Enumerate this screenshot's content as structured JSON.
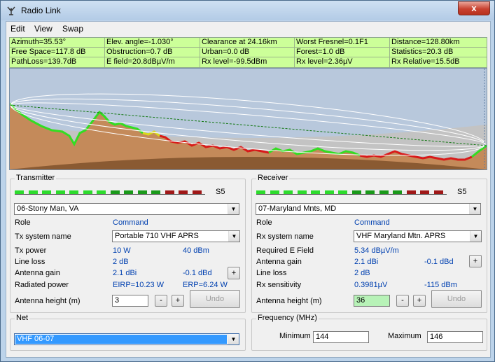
{
  "window": {
    "title": "Radio Link",
    "close_label": "x"
  },
  "menu": {
    "edit": "Edit",
    "view": "View",
    "swap": "Swap"
  },
  "info": {
    "rows": [
      [
        "Azimuth=35.53°",
        "Elev. angle=-1.030°",
        "Clearance at 24.16km",
        "Worst Fresnel=0.1F1",
        "Distance=128.80km"
      ],
      [
        "Free Space=117.8 dB",
        "Obstruction=0.7 dB",
        "Urban=0.0 dB",
        "Forest=1.0 dB",
        "Statistics=20.3 dB"
      ],
      [
        "PathLoss=139.7dB",
        "E field=20.8dBµV/m",
        "Rx level=-99.5dBm",
        "Rx level=2.36µV",
        "Rx Relative=15.5dB"
      ]
    ]
  },
  "colors": {
    "info_bg": "#ccff99",
    "value_blue": "#0040b0",
    "selected_net": "#3399ff",
    "rx_height_bg": "#b7f2b7"
  },
  "meter_colors": [
    "#2ddc2d",
    "#2ddc2d",
    "#2ddc2d",
    "#2ddc2d",
    "#2ddc2d",
    "#2ddc2d",
    "#2ddc2d",
    "#1a9a1a",
    "#1a9a1a",
    "#1a9a1a",
    "#1a9a1a",
    "#a01818",
    "#a01818",
    "#a01818"
  ],
  "transmitter": {
    "legend": "Transmitter",
    "signal": "S5",
    "site": "06-Stony Man, VA",
    "role_label": "Role",
    "role_value": "Command",
    "system_label": "Tx system name",
    "system_value": "Portable 710 VHF APRS",
    "power_label": "Tx power",
    "power_w": "10 W",
    "power_dbm": "40 dBm",
    "loss_label": "Line loss",
    "loss_value": "2 dB",
    "gain_label": "Antenna gain",
    "gain_dbi": "2.1 dBi",
    "gain_dbd": "-0.1 dBd",
    "plus": "+",
    "radiated_label": "Radiated power",
    "eirp": "EIRP=10.23 W",
    "erp": "ERP=6.24 W",
    "height_label": "Antenna height (m)",
    "height_value": "3",
    "minus": "-",
    "undo": "Undo"
  },
  "receiver": {
    "legend": "Receiver",
    "signal": "S5",
    "site": "07-Maryland Mnts, MD",
    "role_label": "Role",
    "role_value": "Command",
    "system_label": "Rx system name",
    "system_value": "VHF Maryland Mtn. APRS",
    "efield_label": "Required E Field",
    "efield_value": "5.34 dBµV/m",
    "gain_label": "Antenna gain",
    "gain_dbi": "2.1 dBi",
    "gain_dbd": "-0.1 dBd",
    "plus": "+",
    "loss_label": "Line loss",
    "loss_value": "2 dB",
    "sens_label": "Rx sensitivity",
    "sens_uv": "0.3981µV",
    "sens_dbm": "-115 dBm",
    "height_label": "Antenna height (m)",
    "height_value": "36",
    "minus": "-",
    "undo": "Undo"
  },
  "net": {
    "legend": "Net",
    "value": "VHF 06-07"
  },
  "frequency": {
    "legend": "Frequency (MHz)",
    "min_label": "Minimum",
    "min_value": "144",
    "max_label": "Maximum",
    "max_value": "146"
  }
}
